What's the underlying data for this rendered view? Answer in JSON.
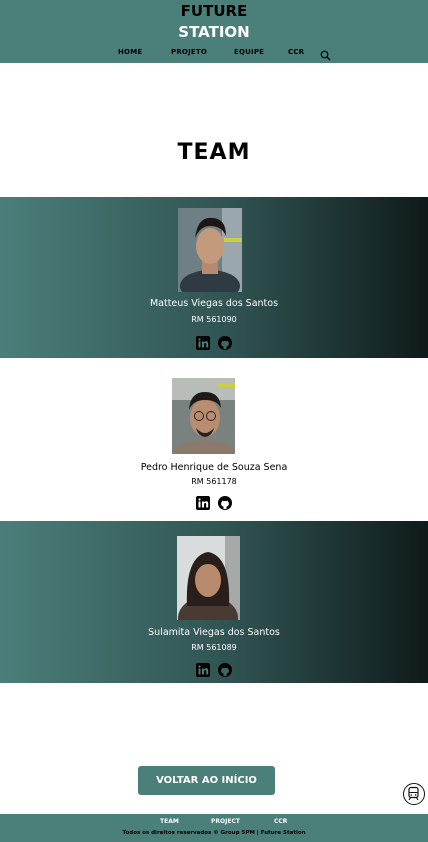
{
  "header": {
    "logo_line1": "FUTURE",
    "logo_line2": "STATION",
    "nav": [
      "HOME",
      "PROJETO",
      "EQUIPE",
      "CCR"
    ]
  },
  "hero": {
    "title": "TEAM"
  },
  "members": [
    {
      "name": "Matteus Viegas dos Santos",
      "rm": "RM 561090"
    },
    {
      "name": "Pedro Henrique de Souza Sena",
      "rm": "RM 561178"
    },
    {
      "name": "Sulamita Viegas dos Santos",
      "rm": "RM 561089"
    }
  ],
  "actions": {
    "back_label": "VOLTAR AO INÍCIO"
  },
  "footer": {
    "links": [
      "TEAM",
      "PROJECT",
      "CCR"
    ],
    "copyright": "Todos os direitos reservados © Group SPM | Future Station"
  },
  "colors": {
    "primary": "#4a7f7a",
    "dark_end": "#0f1a1a"
  },
  "icons": [
    "search-icon",
    "linkedin-icon",
    "github-icon",
    "train-icon"
  ]
}
